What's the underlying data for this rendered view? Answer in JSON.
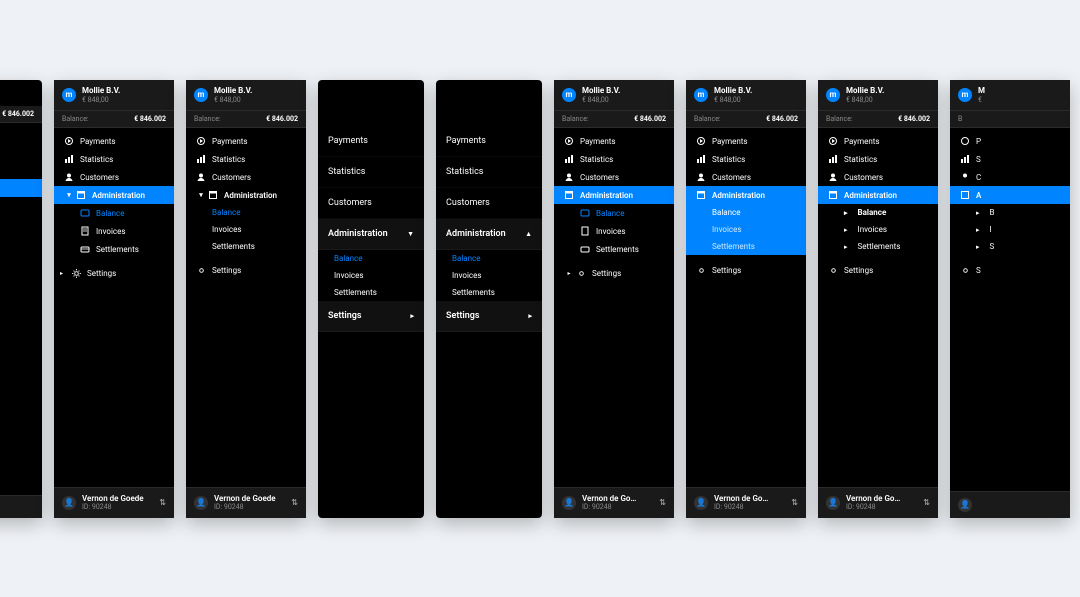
{
  "org": {
    "name": "Mollie B.V.",
    "amount": "€ 848,00"
  },
  "balance": {
    "label": "Balance:",
    "value": "€ 846.002"
  },
  "nav": {
    "payments": "Payments",
    "statistics": "Statistics",
    "customers": "Customers",
    "administration": "Administration",
    "balance": "Balance",
    "invoices": "Invoices",
    "settlements": "Settlements",
    "settings": "Settings"
  },
  "user": {
    "name_full": "Vernon de Goede",
    "name_trunc": "Vernon de Go…",
    "id_label": "ID: 90248"
  },
  "icons": {
    "logo_glyph": "m",
    "avatar_glyph": "👤",
    "sort_glyph": "⇅",
    "chev_down": "▼",
    "chev_up": "▲",
    "chev_right": "▸",
    "bullet": "▸"
  },
  "colors": {
    "accent": "#0084ff",
    "panel": "#000000",
    "header": "#1a1a1a"
  }
}
